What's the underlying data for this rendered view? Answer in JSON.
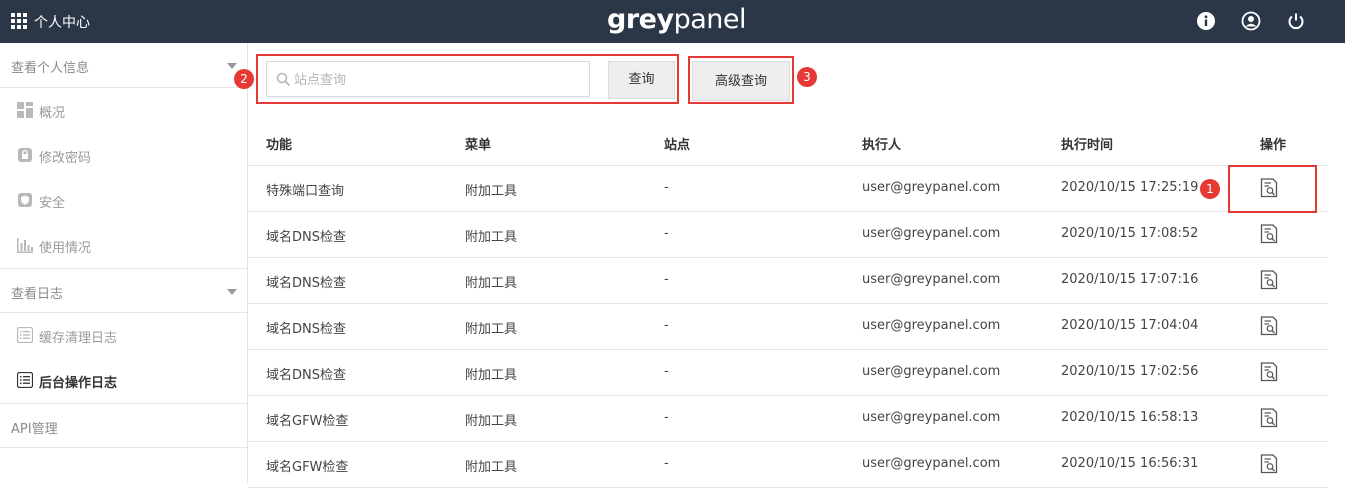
{
  "header": {
    "title": "个人中心",
    "logo_bold": "grey",
    "logo_light": "panel",
    "icons": [
      "info-icon",
      "user-icon",
      "power-icon"
    ]
  },
  "sidebar": {
    "section1": "查看个人信息",
    "items1": [
      {
        "label": "概况",
        "icon": "dashboard-icon"
      },
      {
        "label": "修改密码",
        "icon": "lock-icon"
      },
      {
        "label": "安全",
        "icon": "shield-icon"
      },
      {
        "label": "使用情况",
        "icon": "bar-chart-icon"
      }
    ],
    "section2": "查看日志",
    "items2": [
      {
        "label": "缓存清理日志",
        "icon": "list-icon"
      },
      {
        "label": "后台操作日志",
        "icon": "list-icon",
        "active": true
      }
    ],
    "section3": "API管理"
  },
  "search": {
    "placeholder": "站点查询",
    "query_button": "查询",
    "advanced_button": "高级查询"
  },
  "badges": {
    "one": "1",
    "two": "2",
    "three": "3"
  },
  "table": {
    "headers": [
      "功能",
      "菜单",
      "站点",
      "执行人",
      "执行时间",
      "操作"
    ],
    "rows": [
      [
        "特殊端口查询",
        "附加工具",
        "-",
        "user@greypanel.com",
        "2020/10/15 17:25:19"
      ],
      [
        "域名DNS检查",
        "附加工具",
        "-",
        "user@greypanel.com",
        "2020/10/15 17:08:52"
      ],
      [
        "域名DNS检查",
        "附加工具",
        "-",
        "user@greypanel.com",
        "2020/10/15 17:07:16"
      ],
      [
        "域名DNS检查",
        "附加工具",
        "-",
        "user@greypanel.com",
        "2020/10/15 17:04:04"
      ],
      [
        "域名DNS检查",
        "附加工具",
        "-",
        "user@greypanel.com",
        "2020/10/15 17:02:56"
      ],
      [
        "域名GFW检查",
        "附加工具",
        "-",
        "user@greypanel.com",
        "2020/10/15 16:58:13"
      ],
      [
        "域名GFW检查",
        "附加工具",
        "-",
        "user@greypanel.com",
        "2020/10/15 16:56:31"
      ]
    ]
  },
  "colors": {
    "topbar": "#2b3747",
    "highlight": "#e53935"
  }
}
